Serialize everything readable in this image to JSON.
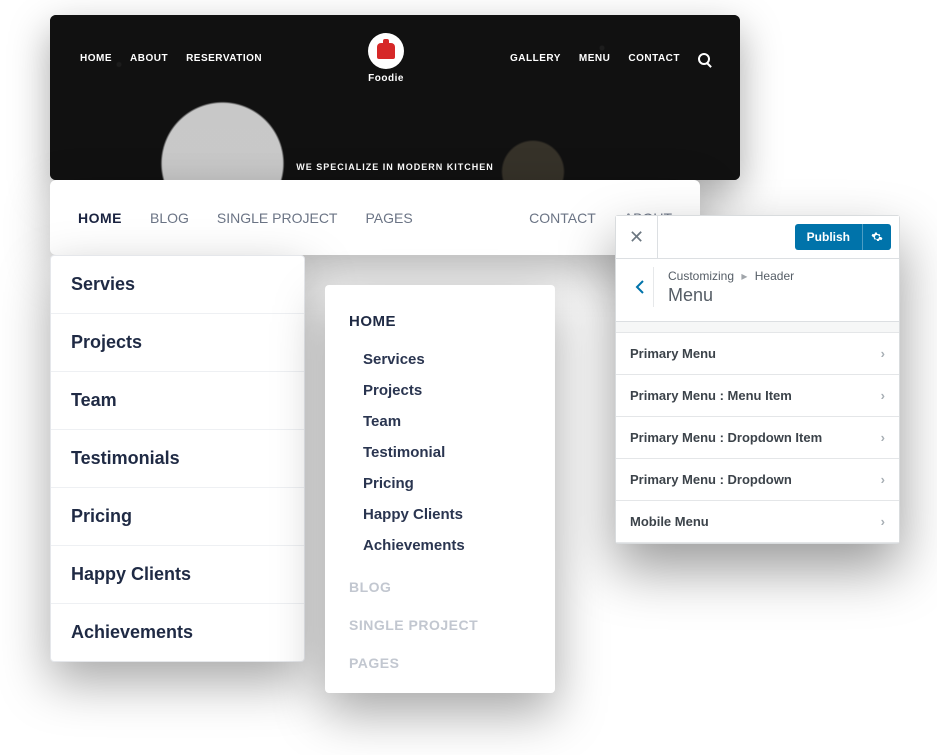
{
  "hero": {
    "nav_left": [
      "HOME",
      "ABOUT",
      "RESERVATION"
    ],
    "nav_right": [
      "GALLERY",
      "MENU",
      "CONTACT"
    ],
    "brand": "Foodie",
    "tagline": "WE SPECIALIZE IN MODERN KITCHEN"
  },
  "navbar": {
    "items": [
      "HOME",
      "BLOG",
      "SINGLE PROJECT",
      "PAGES",
      "CONTACT",
      "ABOUT"
    ],
    "active_index": 0
  },
  "dropdown1": {
    "items": [
      "Servies",
      "Projects",
      "Team",
      "Testimonials",
      "Pricing",
      "Happy Clients",
      "Achievements"
    ]
  },
  "dropdown2": {
    "heading": "HOME",
    "subitems": [
      "Services",
      "Projects",
      "Team",
      "Testimonial",
      "Pricing",
      "Happy Clients",
      "Achievements"
    ],
    "faded": [
      "BLOG",
      "SINGLE PROJECT",
      "PAGES"
    ]
  },
  "customizer": {
    "publish_label": "Publish",
    "breadcrumb_root": "Customizing",
    "breadcrumb_parent": "Header",
    "section_title": "Menu",
    "rows": [
      "Primary Menu",
      "Primary Menu : Menu Item",
      "Primary Menu : Dropdown Item",
      "Primary Menu : Dropdown",
      "Mobile Menu"
    ]
  }
}
